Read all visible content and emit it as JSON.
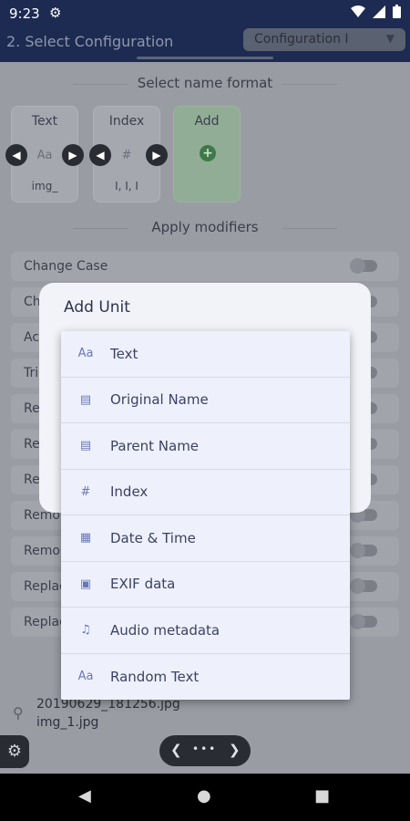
{
  "status_bar": {
    "time": "9:23"
  },
  "app_bar": {
    "title": "2. Select Configuration",
    "config_value": "Configuration I"
  },
  "name_format": {
    "heading": "Select name format",
    "cards": [
      {
        "label": "Text",
        "icon": "Aa",
        "value": "img_"
      },
      {
        "label": "Index",
        "icon": "#",
        "value": "I, I, I"
      },
      {
        "label": "Add"
      }
    ]
  },
  "modifiers": {
    "heading": "Apply modifiers",
    "rows": [
      "Change Case",
      "Ch",
      "Ac",
      "Tri",
      "Re",
      "Re",
      "Re",
      "Remo",
      "Remo",
      "Replac",
      "Replac"
    ]
  },
  "files": [
    "20190629_181256.jpg",
    "img_1.jpg"
  ],
  "dialog": {
    "title": "Add Unit"
  },
  "menu": {
    "items": [
      {
        "label": "Text",
        "icon": "text-format-icon",
        "glyph": "Aa"
      },
      {
        "label": "Original Name",
        "icon": "file-icon",
        "glyph": "▤"
      },
      {
        "label": "Parent Name",
        "icon": "file-icon",
        "glyph": "▤"
      },
      {
        "label": "Index",
        "icon": "hash-icon",
        "glyph": "#"
      },
      {
        "label": "Date & Time",
        "icon": "calendar-icon",
        "glyph": "▦"
      },
      {
        "label": "EXIF data",
        "icon": "image-icon",
        "glyph": "▣"
      },
      {
        "label": "Audio metadata",
        "icon": "music-note-icon",
        "glyph": "♫"
      },
      {
        "label": "Random Text",
        "icon": "text-format-icon",
        "glyph": "Aa"
      }
    ]
  }
}
